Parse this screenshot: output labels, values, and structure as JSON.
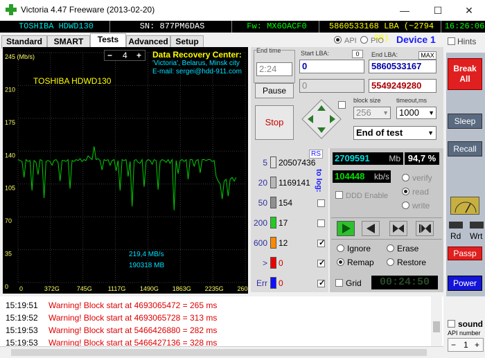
{
  "window": {
    "title": "Victoria 4.47  Freeware (2013-02-20)",
    "minimize": "—",
    "maximize": "☐",
    "close": "✕"
  },
  "infobar": {
    "model": "TOSHIBA HDWD130",
    "serial": "SN: 877PM6DAS",
    "firmware": "Fw: MX6OACF0",
    "lba": "5860533168 LBA (~2794 GB)",
    "time": "16:26:06"
  },
  "tabs": [
    {
      "label": "Standard"
    },
    {
      "label": "SMART"
    },
    {
      "label": "Tests"
    },
    {
      "label": "Advanced"
    },
    {
      "label": "Setup"
    }
  ],
  "port": {
    "api_label": "API",
    "pio_label": "PIO",
    "device": "Device 1",
    "hints": "Hints"
  },
  "graph": {
    "y_unit": "245 (Mb/s)",
    "y_ticks": [
      "245 (Mb/s)",
      "210",
      "175",
      "140",
      "105",
      "70",
      "35",
      "0"
    ],
    "x_ticks": [
      "0",
      "372G",
      "745G",
      "1117G",
      "1490G",
      "1863G",
      "2235G",
      "2608G"
    ],
    "drive_label": "TOSHIBA HDWD130",
    "speed_readout": "219,4 MB/s",
    "pos_readout": "190318 MB",
    "step_minus": "−",
    "step_value": "4",
    "step_plus": "+",
    "dr_title": "Data Recovery Center:",
    "dr_line1": "'Victoria', Belarus, Minsk city",
    "dr_line2": "E-mail: sergei@hdd-911.com"
  },
  "chart_data": {
    "type": "line",
    "title": "",
    "xlabel": "",
    "ylabel": "",
    "ylim": [
      0,
      245
    ],
    "x_ticks": [
      "0",
      "372G",
      "745G",
      "1117G",
      "1490G",
      "1863G",
      "2235G",
      "2608G"
    ],
    "series": [
      {
        "color": "#00d000",
        "values": [
          131,
          130,
          129,
          112,
          131,
          129,
          130,
          98,
          130,
          128,
          115,
          131,
          130,
          90,
          129,
          130,
          129,
          125,
          130,
          131,
          128,
          108,
          130,
          130,
          129,
          131,
          100,
          130,
          129,
          131,
          130,
          132,
          129,
          131,
          130,
          135,
          133,
          131,
          145,
          131,
          132,
          130,
          120,
          131,
          130,
          131,
          125,
          130,
          131,
          119,
          130,
          98,
          131,
          130,
          131,
          113,
          129,
          81,
          130,
          131,
          128,
          127,
          131,
          102,
          129,
          131,
          130,
          126,
          131,
          130,
          99,
          129,
          131,
          130,
          128,
          131,
          127,
          131,
          77,
          130,
          116,
          130,
          131,
          129,
          131,
          110,
          131,
          131,
          124,
          130,
          131,
          117,
          131,
          131,
          130,
          131,
          131,
          129,
          130,
          113,
          108,
          105,
          89,
          108,
          110,
          92,
          110,
          112,
          108,
          112
        ]
      }
    ]
  },
  "test_params": {
    "end_time_label": "End time",
    "end_time_value": "2:24",
    "start_lba_label": "Start LBA:",
    "start_lba_tag": "0",
    "start_lba_value": "0",
    "start_lba_value2": "0",
    "end_lba_label": "End LBA:",
    "end_lba_tag": "MAX",
    "end_lba_value": "5860533167",
    "end_lba_value2": "5549249280",
    "pause_label": "Pause",
    "stop_label": "Stop",
    "block_size_label": "block size",
    "block_size_value": "256",
    "timeout_label": "timeout,ms",
    "timeout_value": "1000",
    "mode_value": "End of test"
  },
  "block_stats": {
    "rs_label": "RS",
    "to_log_label": "to log:",
    "rows": [
      {
        "label": "5",
        "count": "20507436",
        "color": "#e0e0e0",
        "check": ""
      },
      {
        "label": "20",
        "count": "1169141",
        "color": "#b8b8b8",
        "check": ""
      },
      {
        "label": "50",
        "count": "154",
        "color": "#909090",
        "check": "off"
      },
      {
        "label": "200",
        "count": "17",
        "color": "#22cc22",
        "check": "off"
      },
      {
        "label": "600",
        "count": "12",
        "color": "#ff8800",
        "check": "on"
      },
      {
        "label": ">",
        "count": "0",
        "color": "#ee0000",
        "check": "on"
      },
      {
        "label": "Err",
        "count": "0",
        "color": "#1010ff",
        "check": "on"
      }
    ]
  },
  "progress": {
    "mb_value": "2709591",
    "mb_unit": "Mb",
    "percent": "94,7 %",
    "speed_value": "104448",
    "speed_unit": "kb/s",
    "ddd_label": "DDD Enable",
    "verify_label": "verify",
    "read_label": "read",
    "write_label": "write",
    "ignore_label": "Ignore",
    "erase_label": "Erase",
    "remap_label": "Remap",
    "restore_label": "Restore",
    "grid_label": "Grid",
    "elapsed": "00:24:50"
  },
  "sidebar": {
    "break_label": "Break All",
    "sleep_label": "Sleep",
    "recall_label": "Recall",
    "rd_label": "Rd",
    "wrt_label": "Wrt",
    "passp_label": "Passp",
    "power_label": "Power",
    "sound_label": "sound",
    "api_number_label": "API number",
    "api_number_value": "1",
    "api_minus": "−",
    "api_plus": "+"
  },
  "log": [
    {
      "time": "15:19:51",
      "text": "Warning! Block start at 4693065472 = 265 ms"
    },
    {
      "time": "15:19:52",
      "text": "Warning! Block start at 4693065728 = 313 ms"
    },
    {
      "time": "15:19:53",
      "text": "Warning! Block start at 5466426880 = 282 ms"
    },
    {
      "time": "15:19:53",
      "text": "Warning! Block start at 5466427136 = 328 ms"
    }
  ]
}
